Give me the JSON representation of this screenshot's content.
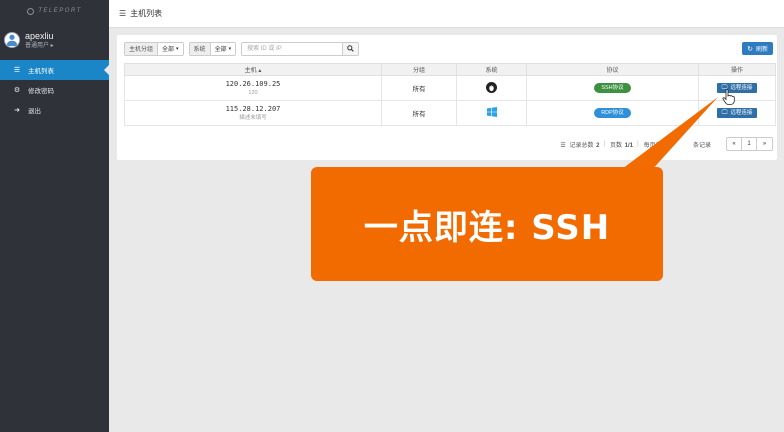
{
  "sidebar": {
    "logo_text": "TELEPORT",
    "user": {
      "name": "apexliu",
      "role": "普通用户 ▸"
    },
    "items": [
      {
        "label": "主机列表",
        "icon": "list-icon",
        "active": true
      },
      {
        "label": "修改密码",
        "icon": "gears-icon",
        "active": false
      },
      {
        "label": "退出",
        "icon": "sign-out-icon",
        "active": false
      }
    ]
  },
  "topbar": {
    "title": "主机列表",
    "icon": "list-icon"
  },
  "filters": {
    "group_label": "主机分组",
    "group_value": "全部",
    "os_label": "系统",
    "os_value": "全部",
    "search_placeholder": "搜索 ID 或 IP",
    "refresh_label": "刷新"
  },
  "table": {
    "headers": [
      "主机 ▴",
      "分组",
      "系统",
      "协议",
      "操作"
    ],
    "rows": [
      {
        "ip": "120.26.109.25",
        "desc": "120",
        "group": "所有",
        "os": "linux-icon",
        "protocol": "SSH协议",
        "protocol_color": "#3d9140",
        "action": "远程连接"
      },
      {
        "ip": "115.28.12.207",
        "desc": "描述未填写",
        "group": "所有",
        "os": "windows-icon",
        "protocol": "RDP协议",
        "protocol_color": "#2f8fd8",
        "action": "远程连接"
      }
    ]
  },
  "pager": {
    "total_label": "记录总数",
    "total_value": "2",
    "page_label": "页数",
    "page_value": "1/1",
    "per_page_label": "每页显示",
    "per_page_suffix": "条记录",
    "current_page": "1",
    "prev_icon": "double-left-icon",
    "next_icon": "double-right-icon"
  },
  "callout": {
    "text": "一点即连: SSH",
    "color": "#f26b00"
  },
  "colors": {
    "sidebar_bg": "#2f3339",
    "active_nav": "#1a86c7",
    "primary_btn": "#2f7bbf"
  }
}
